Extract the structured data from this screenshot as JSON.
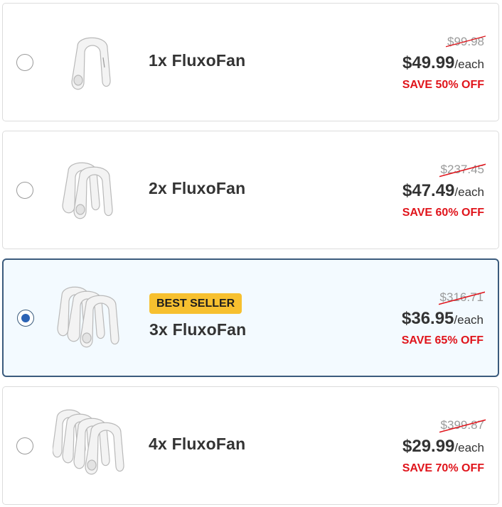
{
  "options": [
    {
      "name": "1x FluxoFan",
      "old_price": "$99.98",
      "price": "$49.99",
      "per": "/each",
      "save": "SAVE 50% OFF",
      "selected": false
    },
    {
      "name": "2x FluxoFan",
      "old_price": "$237.45",
      "price": "$47.49",
      "per": "/each",
      "save": "SAVE 60% OFF",
      "selected": false
    },
    {
      "name": "3x FluxoFan",
      "badge": "BEST SELLER",
      "old_price": "$316.71",
      "price": "$36.95",
      "per": "/each",
      "save": "SAVE 65% OFF",
      "selected": true
    },
    {
      "name": "4x FluxoFan",
      "old_price": "$399.87",
      "price": "$29.99",
      "per": "/each",
      "save": "SAVE 70% OFF",
      "selected": false
    }
  ],
  "colors": {
    "accent": "#2b63b5",
    "badge": "#f7c02f",
    "save": "#e0141b",
    "selected_border": "#3b5b7d",
    "selected_bg": "#f3faff"
  }
}
